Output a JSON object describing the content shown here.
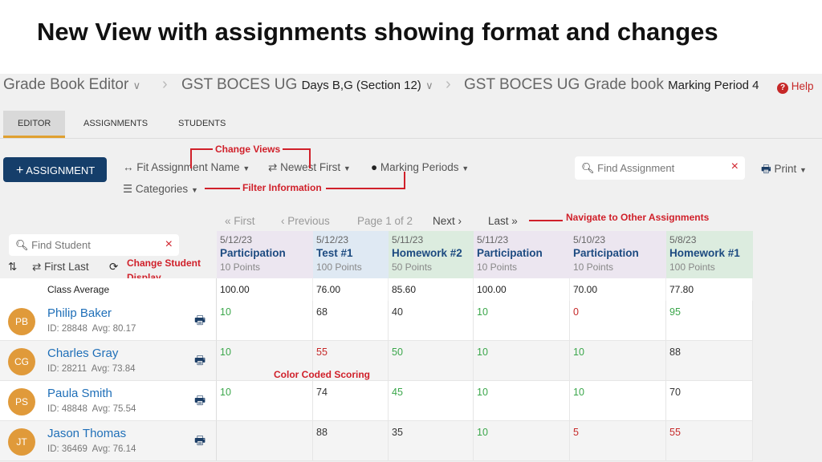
{
  "slide_title": "New View with assignments showing format and changes",
  "breadcrumb": {
    "editor": "Grade Book Editor",
    "course": "GST BOCES UG",
    "section": "Days B,G (Section 12)",
    "gradebook": "GST BOCES UG Grade book",
    "period": "Marking Period 4"
  },
  "help": "Help",
  "tabs": [
    "EDITOR",
    "ASSIGNMENTS",
    "STUDENTS"
  ],
  "toolbar": {
    "add": "ASSIGNMENT",
    "fit": "Fit Assignment Name",
    "sort": "Newest First",
    "periods": "Marking Periods",
    "categories": "Categories",
    "find_placeholder": "Find Assignment",
    "print": "Print"
  },
  "annotations": {
    "views": "Change Views",
    "filter": "Filter Information",
    "navigate": "Navigate to Other Assignments",
    "student": "Change Student",
    "student2": "Display",
    "color": "Color Coded Scoring"
  },
  "pager": {
    "first": "First",
    "previous": "Previous",
    "page": "Page 1 of 2",
    "next": "Next",
    "last": "Last"
  },
  "student_panel": {
    "find_placeholder": "Find Student",
    "order": "First Last",
    "class_average": "Class Average"
  },
  "assignments": [
    {
      "date": "5/12/23",
      "name": "Participation",
      "points": "10 Points",
      "avg": "100.00",
      "bg": "#ece6f0"
    },
    {
      "date": "5/12/23",
      "name": "Test #1",
      "points": "100 Points",
      "avg": "76.00",
      "bg": "#dfe9f3"
    },
    {
      "date": "5/11/23",
      "name": "Homework #2",
      "points": "50 Points",
      "avg": "85.60",
      "bg": "#dcecdf"
    },
    {
      "date": "5/11/23",
      "name": "Participation",
      "points": "10 Points",
      "avg": "100.00",
      "bg": "#ece6f0"
    },
    {
      "date": "5/10/23",
      "name": "Participation",
      "points": "10 Points",
      "avg": "70.00",
      "bg": "#ece6f0"
    },
    {
      "date": "5/8/23",
      "name": "Homework #1",
      "points": "100 Points",
      "avg": "77.80",
      "bg": "#dcecdf"
    }
  ],
  "students": [
    {
      "initials": "PB",
      "name": "Philip Baker",
      "info": "ID: 28848  Avg: 80.17",
      "scores": [
        [
          "10",
          "g"
        ],
        [
          "68",
          "k"
        ],
        [
          "40",
          "k"
        ],
        [
          "10",
          "g"
        ],
        [
          "0",
          "r"
        ],
        [
          "95",
          "g"
        ]
      ]
    },
    {
      "initials": "CG",
      "name": "Charles Gray",
      "info": "ID: 28211  Avg: 73.84",
      "scores": [
        [
          "10",
          "g"
        ],
        [
          "55",
          "r"
        ],
        [
          "50",
          "g"
        ],
        [
          "10",
          "g"
        ],
        [
          "10",
          "g"
        ],
        [
          "88",
          "k"
        ]
      ]
    },
    {
      "initials": "PS",
      "name": "Paula Smith",
      "info": "ID: 48848  Avg: 75.54",
      "scores": [
        [
          "10",
          "g"
        ],
        [
          "74",
          "k"
        ],
        [
          "45",
          "g"
        ],
        [
          "10",
          "g"
        ],
        [
          "10",
          "g"
        ],
        [
          "70",
          "k"
        ]
      ]
    },
    {
      "initials": "JT",
      "name": "Jason Thomas",
      "info": "ID: 36469  Avg: 76.14",
      "scores": [
        [
          "",
          "k"
        ],
        [
          "88",
          "k"
        ],
        [
          "35",
          "k"
        ],
        [
          "10",
          "g"
        ],
        [
          "5",
          "r"
        ],
        [
          "55",
          "r"
        ]
      ]
    }
  ]
}
